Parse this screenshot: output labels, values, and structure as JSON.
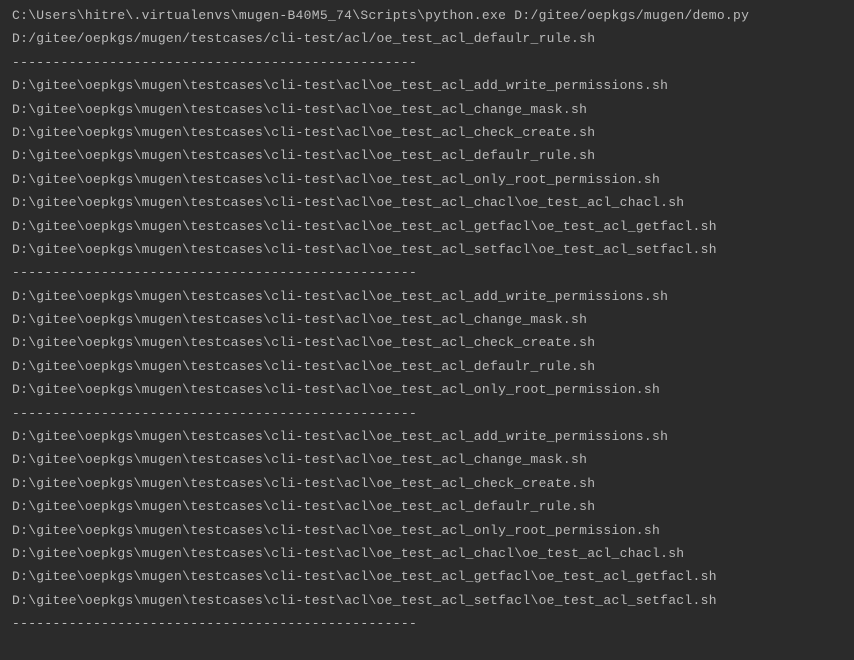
{
  "command": {
    "python_exe": "C:\\Users\\hitre\\.virtualenvs\\mugen-B40M5_74\\Scripts\\python.exe",
    "script_path": "D:/gitee/oepkgs/mugen/demo.py"
  },
  "initial_path": "D:/gitee/oepkgs/mugen/testcases/cli-test/acl/oe_test_acl_defaulr_rule.sh",
  "separator": "--------------------------------------------------",
  "blocks": [
    {
      "paths": [
        "D:\\gitee\\oepkgs\\mugen\\testcases\\cli-test\\acl\\oe_test_acl_add_write_permissions.sh",
        "D:\\gitee\\oepkgs\\mugen\\testcases\\cli-test\\acl\\oe_test_acl_change_mask.sh",
        "D:\\gitee\\oepkgs\\mugen\\testcases\\cli-test\\acl\\oe_test_acl_check_create.sh",
        "D:\\gitee\\oepkgs\\mugen\\testcases\\cli-test\\acl\\oe_test_acl_defaulr_rule.sh",
        "D:\\gitee\\oepkgs\\mugen\\testcases\\cli-test\\acl\\oe_test_acl_only_root_permission.sh",
        "D:\\gitee\\oepkgs\\mugen\\testcases\\cli-test\\acl\\oe_test_acl_chacl\\oe_test_acl_chacl.sh",
        "D:\\gitee\\oepkgs\\mugen\\testcases\\cli-test\\acl\\oe_test_acl_getfacl\\oe_test_acl_getfacl.sh",
        "D:\\gitee\\oepkgs\\mugen\\testcases\\cli-test\\acl\\oe_test_acl_setfacl\\oe_test_acl_setfacl.sh"
      ]
    },
    {
      "paths": [
        "D:\\gitee\\oepkgs\\mugen\\testcases\\cli-test\\acl\\oe_test_acl_add_write_permissions.sh",
        "D:\\gitee\\oepkgs\\mugen\\testcases\\cli-test\\acl\\oe_test_acl_change_mask.sh",
        "D:\\gitee\\oepkgs\\mugen\\testcases\\cli-test\\acl\\oe_test_acl_check_create.sh",
        "D:\\gitee\\oepkgs\\mugen\\testcases\\cli-test\\acl\\oe_test_acl_defaulr_rule.sh",
        "D:\\gitee\\oepkgs\\mugen\\testcases\\cli-test\\acl\\oe_test_acl_only_root_permission.sh"
      ]
    },
    {
      "paths": [
        "D:\\gitee\\oepkgs\\mugen\\testcases\\cli-test\\acl\\oe_test_acl_add_write_permissions.sh",
        "D:\\gitee\\oepkgs\\mugen\\testcases\\cli-test\\acl\\oe_test_acl_change_mask.sh",
        "D:\\gitee\\oepkgs\\mugen\\testcases\\cli-test\\acl\\oe_test_acl_check_create.sh",
        "D:\\gitee\\oepkgs\\mugen\\testcases\\cli-test\\acl\\oe_test_acl_defaulr_rule.sh",
        "D:\\gitee\\oepkgs\\mugen\\testcases\\cli-test\\acl\\oe_test_acl_only_root_permission.sh",
        "D:\\gitee\\oepkgs\\mugen\\testcases\\cli-test\\acl\\oe_test_acl_chacl\\oe_test_acl_chacl.sh",
        "D:\\gitee\\oepkgs\\mugen\\testcases\\cli-test\\acl\\oe_test_acl_getfacl\\oe_test_acl_getfacl.sh",
        "D:\\gitee\\oepkgs\\mugen\\testcases\\cli-test\\acl\\oe_test_acl_setfacl\\oe_test_acl_setfacl.sh"
      ]
    }
  ]
}
